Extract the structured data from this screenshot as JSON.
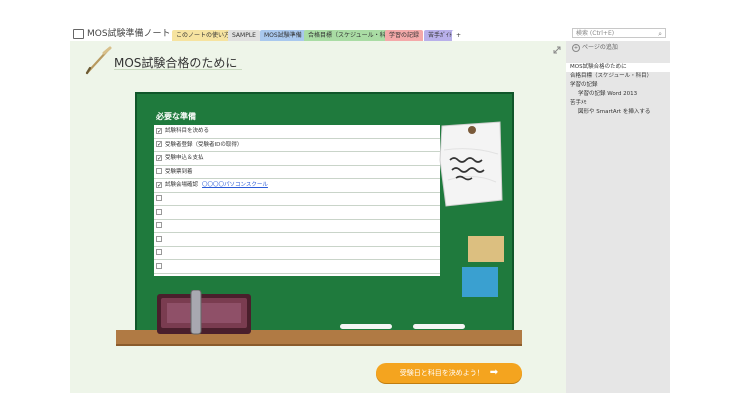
{
  "notebook": {
    "title": "MOS試験準備ノート ▾"
  },
  "tabs": [
    {
      "label": "このノートの使い方",
      "color": "#f6e3a0"
    },
    {
      "label": "SAMPLE",
      "color": "#e0e0e0"
    },
    {
      "label": "MOS試験準備",
      "color": "#a9c8ee"
    },
    {
      "label": "合格目標（スケジュール・科目）",
      "color": "#a9dca4"
    },
    {
      "label": "学習の記録",
      "color": "#f4a9a9"
    },
    {
      "label": "苦手ｶﾞｲﾄﾞ",
      "color": "#b8b0ea"
    },
    {
      "label": "+",
      "color": "#ffffff"
    }
  ],
  "search": {
    "placeholder": "検索 (Ctrl+E)"
  },
  "page": {
    "title": "MOS試験合格のために"
  },
  "checklist": {
    "title": "必要な準備",
    "items": [
      {
        "checked": true,
        "text": "試験科目を決める",
        "link": ""
      },
      {
        "checked": true,
        "text": "受験者登録（受験者IDの取得）",
        "link": ""
      },
      {
        "checked": true,
        "text": "受験申込＆支払",
        "link": ""
      },
      {
        "checked": false,
        "text": "受験票到着",
        "link": ""
      },
      {
        "checked": true,
        "text": "試験会場確認",
        "link": "〇〇〇〇パソコンスクール"
      },
      {
        "checked": false,
        "text": "",
        "link": ""
      },
      {
        "checked": false,
        "text": "",
        "link": ""
      },
      {
        "checked": false,
        "text": "",
        "link": ""
      },
      {
        "checked": false,
        "text": "",
        "link": ""
      },
      {
        "checked": false,
        "text": "",
        "link": ""
      },
      {
        "checked": false,
        "text": "",
        "link": ""
      }
    ]
  },
  "next_button": {
    "label": "受験日と科目を決めよう！"
  },
  "sidebar": {
    "add_page": "ページの追加",
    "pages": [
      {
        "label": "MOS試験合格のために",
        "indent": 0,
        "selected": true
      },
      {
        "label": "合格目標（スケジュール・科目）",
        "indent": 0,
        "selected": false
      },
      {
        "label": "学習の記録",
        "indent": 0,
        "selected": false
      },
      {
        "label": "学習の記録 Word 2013",
        "indent": 1,
        "selected": false
      },
      {
        "label": "苦手ﾒﾓ",
        "indent": 0,
        "selected": false
      },
      {
        "label": "図形や SmartArt を挿入する",
        "indent": 1,
        "selected": false
      }
    ]
  }
}
